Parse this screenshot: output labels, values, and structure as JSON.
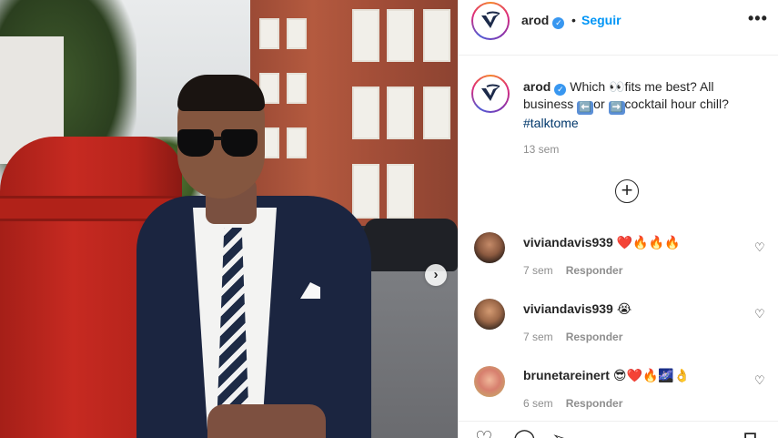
{
  "post": {
    "username": "arod",
    "follow_label": "Seguir",
    "dot": "•",
    "more_label": "•••",
    "next_label": "›",
    "verified_glyph": "✓",
    "caption_parts": {
      "text1": "Which ",
      "eyes_emoji": "👀",
      "text2": "fits me best? All business ",
      "left_arrow": "⬅️",
      "text3": "or ",
      "right_arrow": "➡️",
      "text4": "cocktail hour chill?",
      "hashtag": "#talktome"
    },
    "time_ago": "13 sem",
    "load_more_label": "+"
  },
  "comments": [
    {
      "username": "viviandavis939",
      "text": "❤️🔥🔥🔥",
      "time": "7 sem",
      "reply_label": "Responder"
    },
    {
      "username": "viviandavis939",
      "text": "😭",
      "time": "7 sem",
      "reply_label": "Responder"
    },
    {
      "username": "brunetareinert",
      "text": "😎❤️🔥🌌👌",
      "time": "6 sem",
      "reply_label": "Responder"
    }
  ],
  "icons": {
    "heart_small": "♡",
    "like": "♡",
    "comment": "◯",
    "share": "➢",
    "save": "⊓"
  },
  "colors": {
    "accent_blue": "#0095f6",
    "verified_blue": "#3897f0",
    "hashtag": "#00376b",
    "muted": "#8e8e8e"
  }
}
